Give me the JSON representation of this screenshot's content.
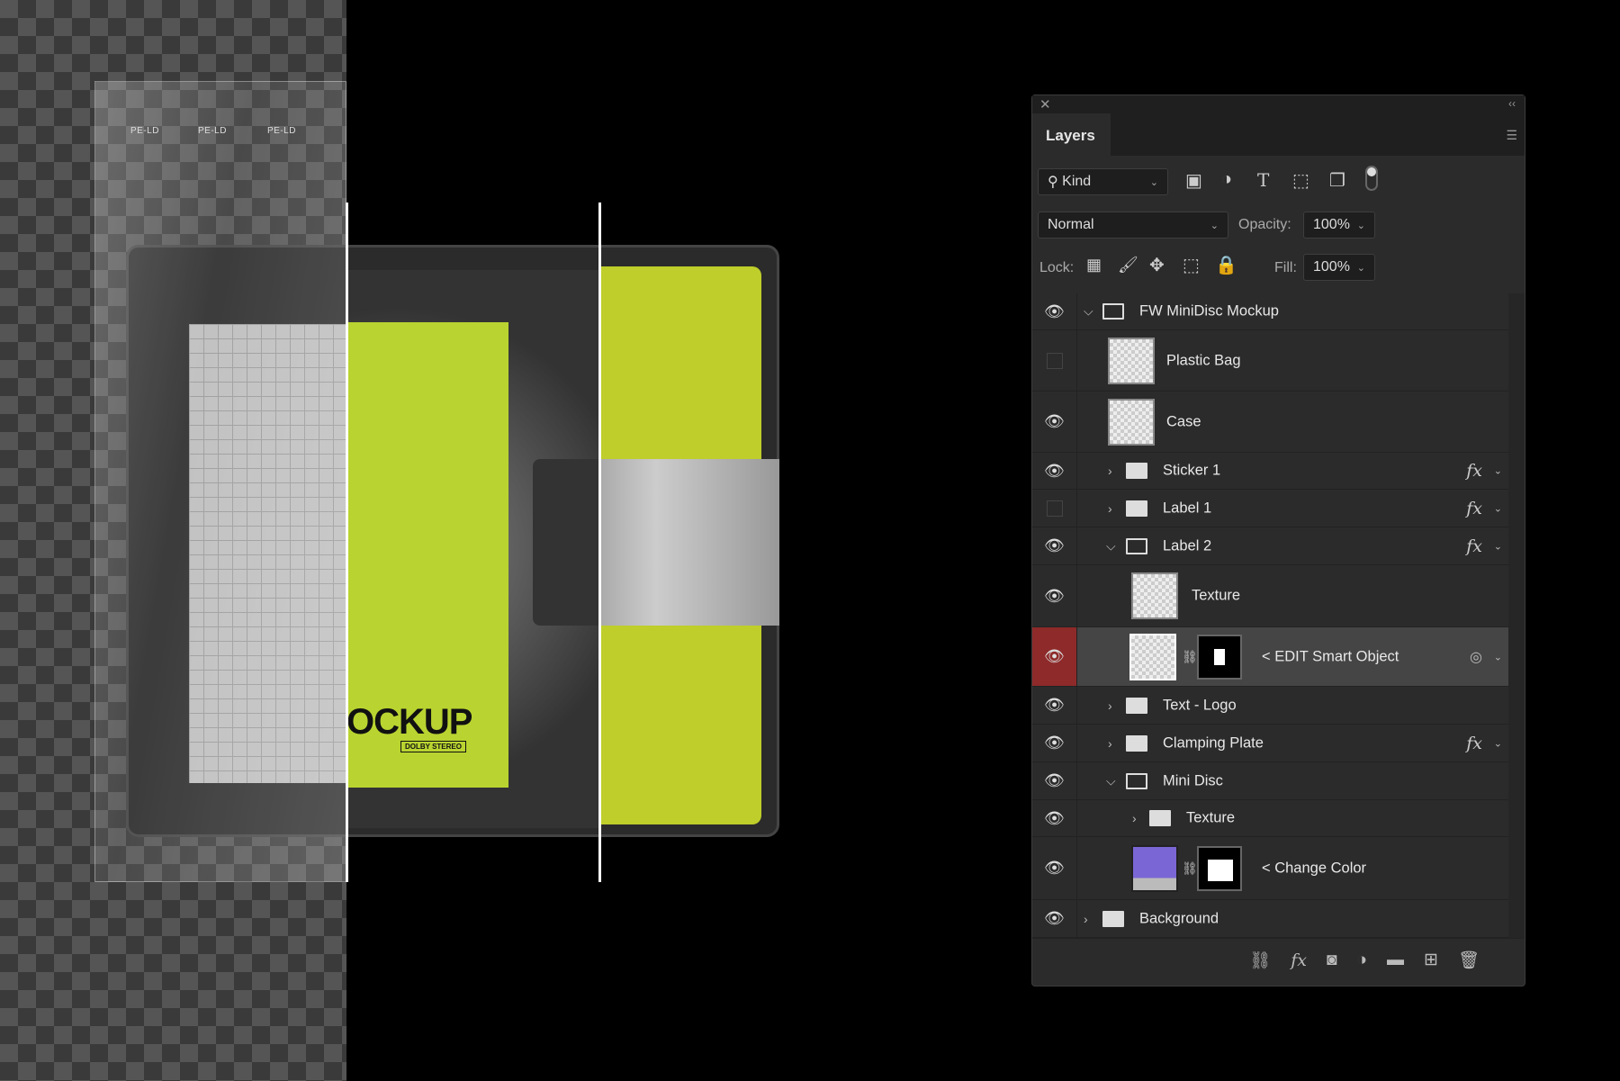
{
  "artwork": {
    "label_text": "OCKUP",
    "badge_text": "DOLBY STEREO",
    "bag_print": "PE-LD"
  },
  "panel": {
    "close_icon": "close-icon",
    "collapse_icon": "double-chevron-left-icon",
    "tab": "Layers",
    "filter": {
      "label": "Kind"
    },
    "blend_mode": "Normal",
    "opacity_label": "Opacity:",
    "opacity": "100%",
    "lock_label": "Lock:",
    "fill_label": "Fill:",
    "fill": "100%",
    "layers": [
      {
        "name": "FW MiniDisc Mockup",
        "visible": true,
        "type": "group",
        "expanded": true
      },
      {
        "name": "Plastic Bag",
        "visible": false,
        "type": "smart-object"
      },
      {
        "name": "Case",
        "visible": true,
        "type": "smart-object"
      },
      {
        "name": "Sticker 1",
        "visible": true,
        "type": "group",
        "fx": "fx"
      },
      {
        "name": "Label 1",
        "visible": false,
        "type": "group",
        "fx": "fx"
      },
      {
        "name": "Label 2",
        "visible": true,
        "type": "group",
        "expanded": true,
        "fx": "fx"
      },
      {
        "name": "Texture",
        "visible": true,
        "type": "layer"
      },
      {
        "name": "< EDIT Smart Object",
        "visible": true,
        "type": "smart-object",
        "selected": true
      },
      {
        "name": "Text - Logo",
        "visible": true,
        "type": "group"
      },
      {
        "name": "Clamping Plate",
        "visible": true,
        "type": "group",
        "fx": "fx"
      },
      {
        "name": "Mini Disc",
        "visible": true,
        "type": "group",
        "expanded": true
      },
      {
        "name": "Texture",
        "visible": true,
        "type": "group"
      },
      {
        "name": "< Change Color",
        "visible": true,
        "type": "fill-layer",
        "color": "#7b66d6"
      },
      {
        "name": "Background",
        "visible": true,
        "type": "group"
      }
    ],
    "colors": {
      "selected_eye": "#8e2a2a",
      "label_green": "#b9d430"
    }
  }
}
